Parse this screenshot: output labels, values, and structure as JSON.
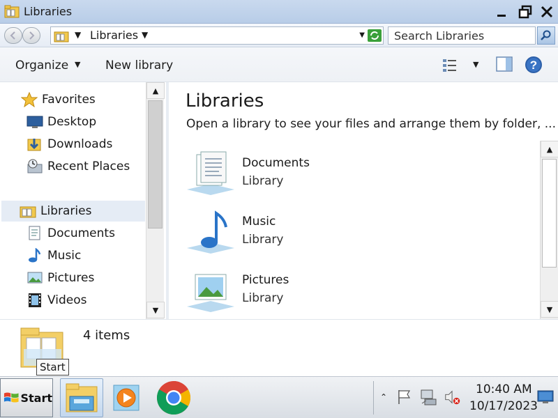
{
  "window": {
    "title": "Libraries"
  },
  "address": {
    "breadcrumb": "Libraries",
    "search_placeholder": "Search Libraries"
  },
  "toolbar": {
    "organize_label": "Organize",
    "new_library_label": "New library"
  },
  "nav": {
    "favorites_label": "Favorites",
    "favorites": [
      {
        "label": "Desktop",
        "icon": "desktop-icon"
      },
      {
        "label": "Downloads",
        "icon": "downloads-icon"
      },
      {
        "label": "Recent Places",
        "icon": "recent-places-icon"
      }
    ],
    "libraries_label": "Libraries",
    "libraries": [
      {
        "label": "Documents",
        "icon": "documents-icon"
      },
      {
        "label": "Music",
        "icon": "music-icon"
      },
      {
        "label": "Pictures",
        "icon": "pictures-icon"
      },
      {
        "label": "Videos",
        "icon": "videos-icon"
      }
    ]
  },
  "content": {
    "heading": "Libraries",
    "subtitle": "Open a library to see your files and arrange them by folder, ...",
    "items": [
      {
        "name": "Documents",
        "type": "Library",
        "icon": "documents-library-icon"
      },
      {
        "name": "Music",
        "type": "Library",
        "icon": "music-library-icon"
      },
      {
        "name": "Pictures",
        "type": "Library",
        "icon": "pictures-library-icon"
      }
    ]
  },
  "details": {
    "count": "4 items"
  },
  "tooltip": {
    "text": "Start"
  },
  "taskbar": {
    "start_label": "Start",
    "apps": [
      "windows-explorer-icon",
      "media-player-icon",
      "chrome-icon"
    ],
    "time": "10:40 AM",
    "date": "10/17/2023"
  },
  "colors": {
    "accent": "#3a7bd5",
    "selection": "#e5ecf5",
    "titlebar": "#c9d9ee"
  }
}
